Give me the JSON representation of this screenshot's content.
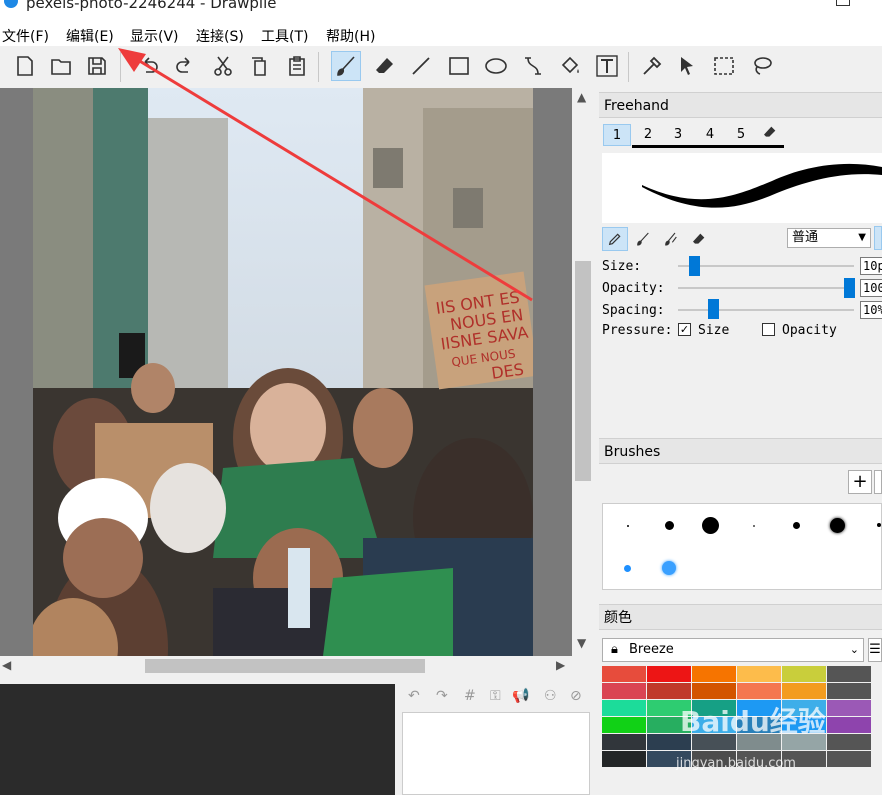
{
  "window": {
    "title": "pexels-photo-2246244 - Drawpile"
  },
  "menu": [
    "文件(F)",
    "编辑(E)",
    "显示(V)",
    "连接(S)",
    "工具(T)",
    "帮助(H)"
  ],
  "photo": {
    "signs": [
      [
        "IIS ONT ES",
        "NOUS EN",
        "IISNE SAVA",
        "QUE NOUS",
        "DES"
      ]
    ]
  },
  "dock": {
    "freehand": {
      "title": "Freehand",
      "tabs": [
        "1",
        "2",
        "3",
        "4",
        "5"
      ],
      "blend_mode": "普通",
      "size_label": "Size:",
      "size_value": "10p",
      "opacity_label": "Opacity:",
      "opacity_value": "100",
      "spacing_label": "Spacing:",
      "spacing_value": "10%",
      "pressure_label": "Pressure:",
      "pressure_size_label": "Size",
      "pressure_opacity_label": "Opacity",
      "pressure_size_checked": true,
      "pressure_opacity_checked": false,
      "size_level": 0.1,
      "opacity_level": 1.0,
      "spacing_level": 0.2
    },
    "brushes": {
      "title": "Brushes",
      "add_label": "+"
    },
    "colors": {
      "title": "颜色",
      "palette_name": "Breeze",
      "swatches": [
        [
          "#e74c3c",
          "#ed1515",
          "#f67400",
          "#fdbc4b",
          "#c9ce3b",
          "#555555"
        ],
        [
          "#da4453",
          "#c0392b",
          "#d35400",
          "#f47750",
          "#f39c1f",
          "#555555"
        ],
        [
          "#1cdc9a",
          "#2ecc71",
          "#16a085",
          "#1d99f3",
          "#3daee9",
          "#9b59b6"
        ],
        [
          "#11d116",
          "#27ae60",
          "#3daee9",
          "#2980b9",
          "#1d99f3",
          "#8e44ad"
        ],
        [
          "#31363b",
          "#2c3e50",
          "#475057",
          "#7f8c8d",
          "#95a5a6",
          "#555555"
        ],
        [
          "#232627",
          "#34495e",
          "#4d4d4d",
          "#555555",
          "#555555",
          "#555555"
        ]
      ]
    }
  },
  "watermark": {
    "main": "Baidu经验",
    "sub": "jingyan.baidu.com"
  }
}
